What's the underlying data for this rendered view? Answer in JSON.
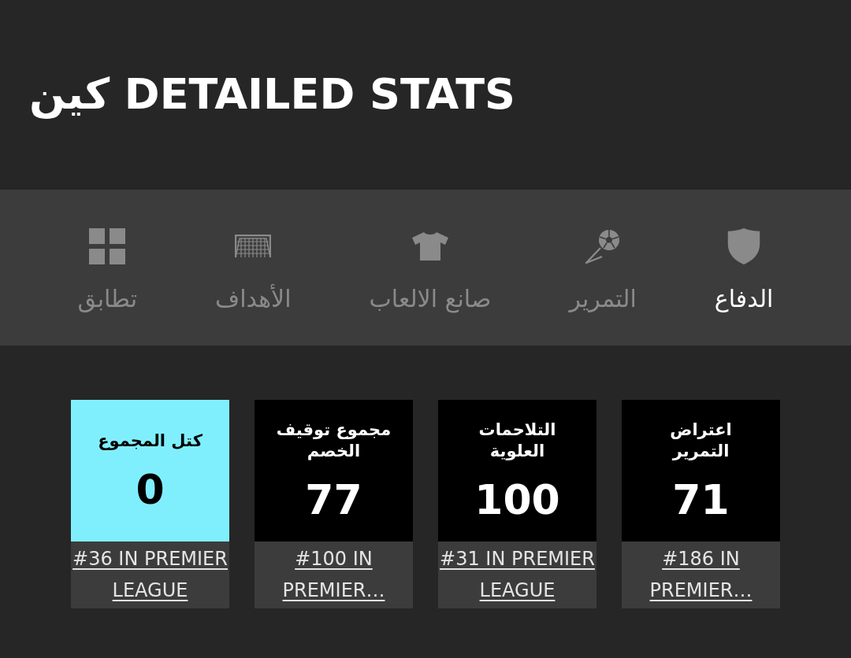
{
  "header": {
    "title": "كين DETAILED STATS"
  },
  "tabs": [
    {
      "label": "الدفاع",
      "selected": true
    },
    {
      "label": "التمرير",
      "selected": false
    },
    {
      "label": "صانع الالعاب",
      "selected": false
    },
    {
      "label": "الأهداف",
      "selected": false
    },
    {
      "label": "تطابق",
      "selected": false
    }
  ],
  "cards": [
    {
      "label": "اعتراض التمرير",
      "value": "71",
      "rank": "#186 IN PREMIER…",
      "highlighted": false
    },
    {
      "label": "التلاحمات العلوية",
      "value": "100",
      "rank": "#31 IN PREMIER LEAGUE",
      "highlighted": false
    },
    {
      "label": "مجموع توقيف الخصم",
      "value": "77",
      "rank": "#100 IN PREMIER…",
      "highlighted": false
    },
    {
      "label": "كتل المجموع",
      "value": "0",
      "rank": "#36 IN PREMIER LEAGUE",
      "highlighted": true
    }
  ]
}
